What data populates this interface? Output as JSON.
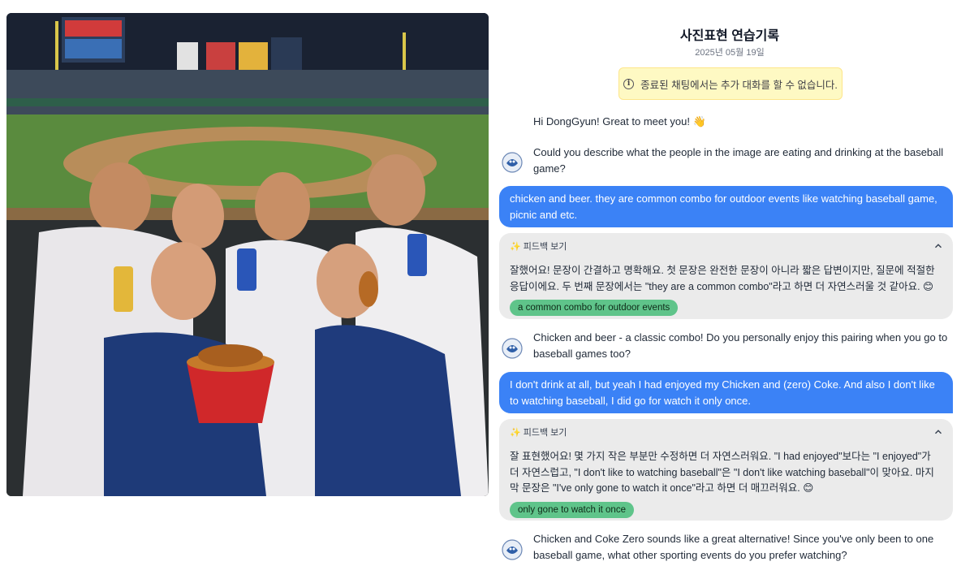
{
  "header": {
    "title": "사진표현 연습기록",
    "date": "2025년 05월 19일"
  },
  "notice": {
    "icon": "info-icon",
    "text": "종료된 채팅에서는 추가 대화를 할 수 없습니다."
  },
  "messages": {
    "m0": "Hi DongGyun! Great to meet you! 👋",
    "m1": "Could you describe what the people in the image are eating and drinking at the baseball game?",
    "u1": "chicken and beer. they are common combo for outdoor events like watching baseball game, picnic and etc.",
    "m2": "Chicken and beer - a classic combo! Do you personally enjoy this pairing when you go to baseball games too?",
    "u2": "I don't drink at all, but yeah I had enjoyed my Chicken and (zero) Coke. And also I don't like to watching baseball, I did go for watch it only once.",
    "m3": "Chicken and Coke Zero sounds like a great alternative! Since you've only been to one baseball game, what other sporting events do you prefer watching?"
  },
  "feedback1": {
    "toggle_label": "✨ 피드백 보기",
    "body": "잘했어요! 문장이 간결하고 명확해요. 첫 문장은 완전한 문장이 아니라 짧은 답변이지만, 질문에 적절한 응답이에요. 두 번째 문장에서는 \"they are a common combo\"라고 하면 더 자연스러울 것 같아요. 😊",
    "chip": "a common combo for outdoor events"
  },
  "feedback2": {
    "toggle_label": "✨ 피드백 보기",
    "body": "잘 표현했어요! 몇 가지 작은 부분만 수정하면 더 자연스러워요. \"I had enjoyed\"보다는 \"I enjoyed\"가 더 자연스럽고, \"I don't like to watching baseball\"은 \"I don't like watching baseball\"이 맞아요. 마지막 문장은 \"I've only gone to watch it once\"라고 하면 더 매끄러워요. 😊",
    "chip": "only gone to watch it once"
  },
  "colors": {
    "user_bubble": "#3b82f6",
    "feedback_bg": "#ebebeb",
    "chip": "#5fc48a",
    "notice_bg": "#fef9c3"
  }
}
